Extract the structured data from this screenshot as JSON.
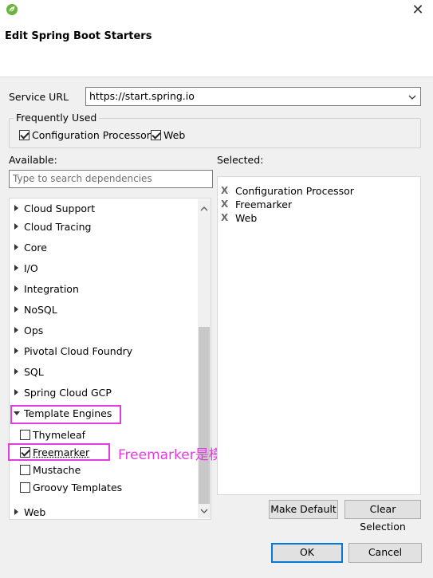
{
  "dialog": {
    "title": "Edit Spring Boot Starters",
    "close_symbol": "✕"
  },
  "service_url": {
    "label": "Service URL",
    "value": "https://start.spring.io"
  },
  "frequently_used": {
    "legend": "Frequently Used",
    "items": [
      {
        "label": "Configuration Processor",
        "checked": true
      },
      {
        "label": "Web",
        "checked": true
      }
    ]
  },
  "available": {
    "label": "Available:",
    "search_placeholder": "Type to search dependencies",
    "tree": [
      {
        "label": "Cloud Support",
        "expanded": false
      },
      {
        "label": "Cloud Tracing",
        "expanded": false
      },
      {
        "label": "Core",
        "expanded": false
      },
      {
        "label": "I/O",
        "expanded": false
      },
      {
        "label": "Integration",
        "expanded": false
      },
      {
        "label": "NoSQL",
        "expanded": false
      },
      {
        "label": "Ops",
        "expanded": false
      },
      {
        "label": "Pivotal Cloud Foundry",
        "expanded": false
      },
      {
        "label": "SQL",
        "expanded": false
      },
      {
        "label": "Spring Cloud GCP",
        "expanded": false
      },
      {
        "label": "Template Engines",
        "expanded": true,
        "children": [
          {
            "label": "Thymeleaf",
            "checked": false
          },
          {
            "label": "Freemarker",
            "checked": true
          },
          {
            "label": "Mustache",
            "checked": false
          },
          {
            "label": "Groovy Templates",
            "checked": false
          }
        ]
      },
      {
        "label": "Web",
        "expanded": false
      }
    ]
  },
  "selected": {
    "label": "Selected:",
    "remove_symbol": "X",
    "items": [
      "Configuration Processor",
      "Freemarker",
      "Web"
    ]
  },
  "buttons": {
    "make_default": "Make Default",
    "clear_selection": "Clear Selection",
    "ok": "OK",
    "cancel": "Cancel"
  },
  "annotation": {
    "text": "Freemarker是模板引擎",
    "color": "#e03ce0"
  },
  "colors": {
    "spring_green": "#6db33f",
    "focus_blue": "#0078d7"
  }
}
